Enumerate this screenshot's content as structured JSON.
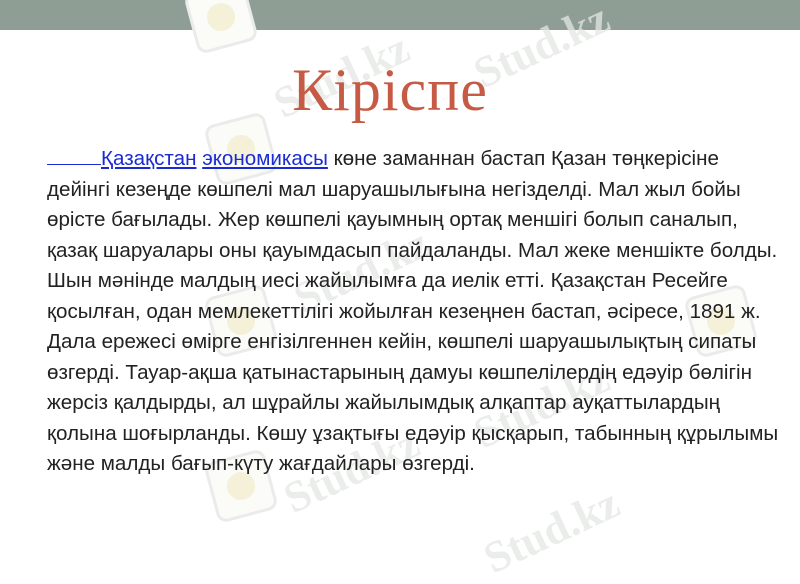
{
  "slide": {
    "title": "Кіріспе",
    "link_kazakhstan": "Қазақстан",
    "link_economy": "экономикасы",
    "body_text": " көне заманнан бастап Қазан төңкерісіне дейінгі кезеңде көшпелі мал шаруашылығына негізделді. Мал жыл бойы өрісте бағылады. Жер көшпелі қауымның ортақ меншігі болып саналып, қазақ шаруалары оны қауымдасып пайдаланды. Мал жеке меншікте болды. Шын мәнінде малдың иесі жайылымға да иелік етті. Қазақстан Ресейге қосылған, одан мемлекеттілігі жойылған кезеңнен бастап, әсіресе, 1891 ж. Дала ережесі өмірге енгізілгеннен кейін, көшпелі шаруашылықтың сипаты өзгерді. Тауар-ақша қатынастарының дамуы көшпелілердің едәуір бөлігін жерсіз қалдырды, ал шұрайлы жайылымдық алқаптар ауқаттылардың қолына шоғырланды. Көшу ұзақтығы едәуір қысқарып, табынның құрылымы және малды бағып-күту жағдайлары өзгерді."
  },
  "watermark": {
    "text": "Stud.kz"
  },
  "colors": {
    "title": "#c65a44",
    "link": "#1a2bd4",
    "top_bar": "#8f9e94"
  }
}
